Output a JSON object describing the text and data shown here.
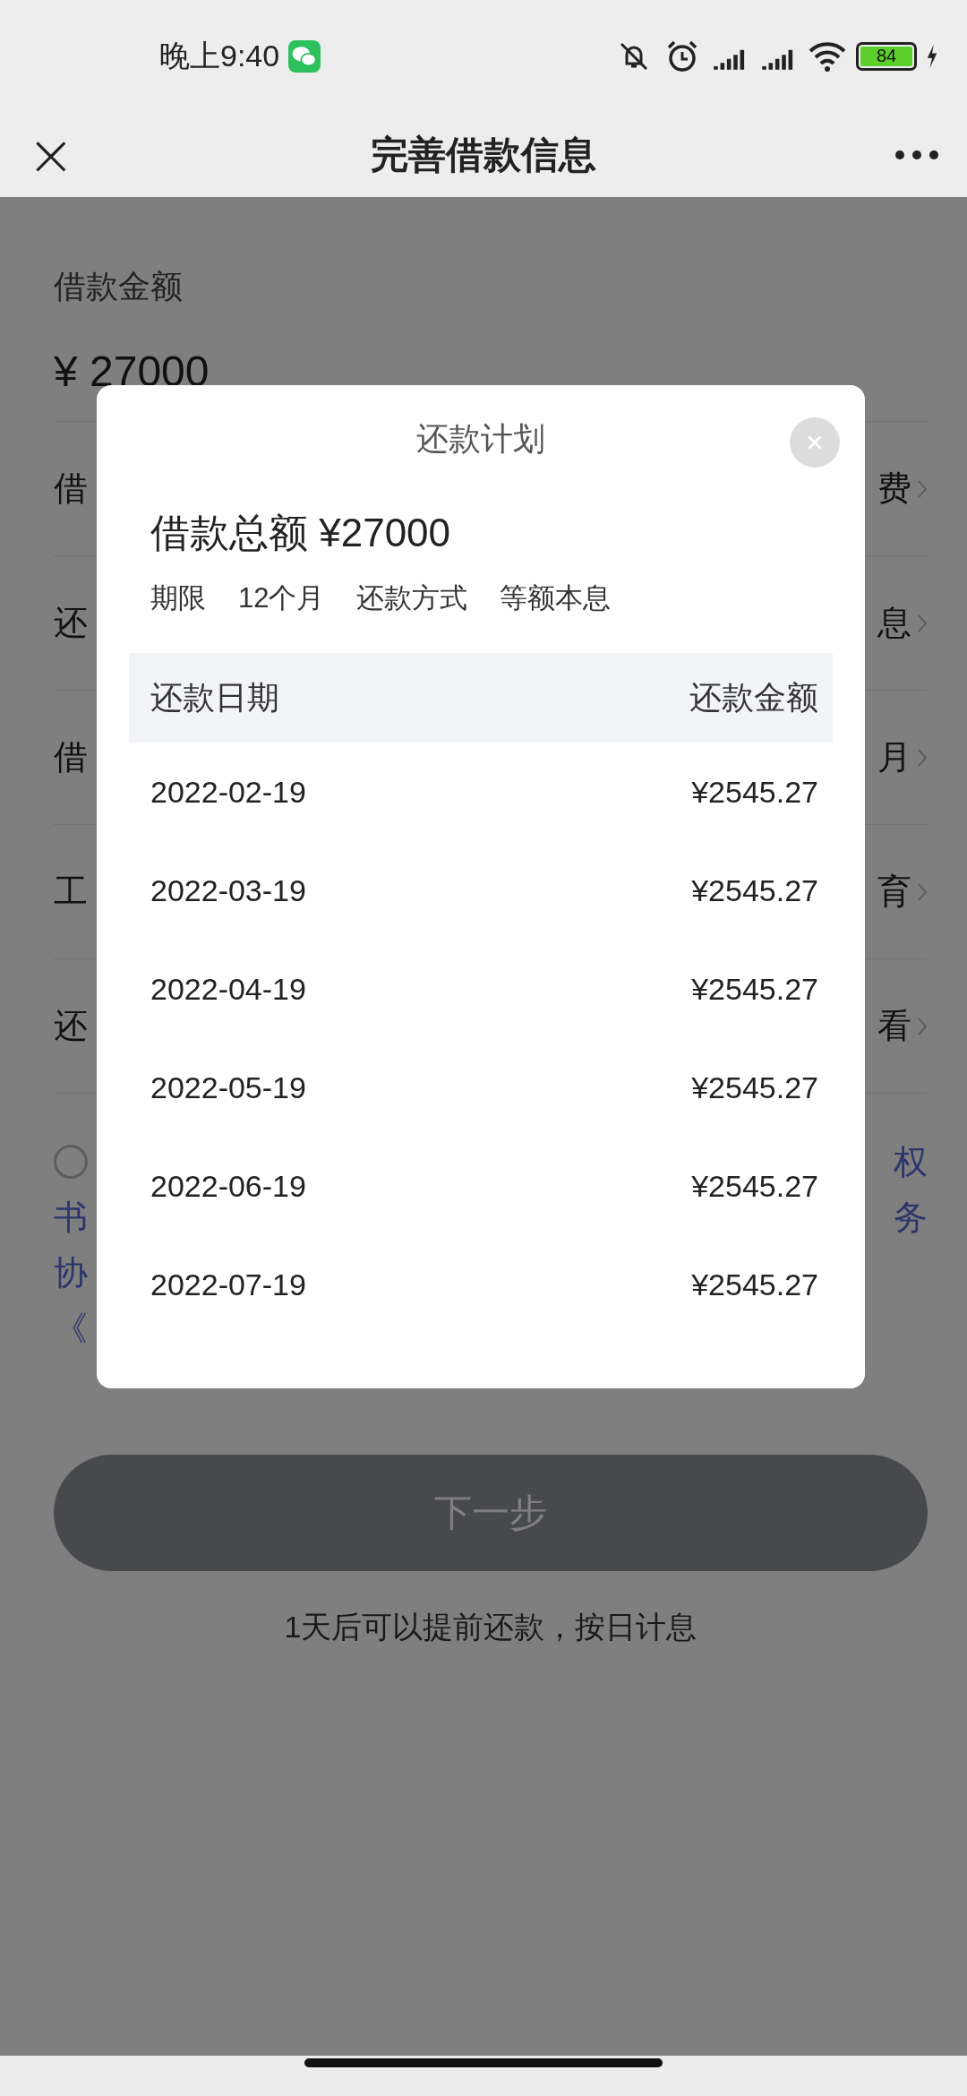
{
  "status_bar": {
    "time": "晚上9:40",
    "battery": "84"
  },
  "nav_bar": {
    "close": "×",
    "title": "完善借款信息"
  },
  "form": {
    "amount_label": "借款金额",
    "amount_value": "¥ 27000",
    "rows": [
      {
        "label": "借",
        "value": "费"
      },
      {
        "label": "还",
        "value": "息"
      },
      {
        "label": "借",
        "value": "月"
      },
      {
        "label": "工",
        "value": "育"
      },
      {
        "label": "还",
        "value": "看"
      }
    ],
    "agreement": {
      "checked": false,
      "lines": [
        {
          "right": "权"
        },
        {
          "left": "书",
          "right": "务"
        },
        {
          "left": "协"
        },
        {
          "left": "《"
        }
      ]
    },
    "next_button": {
      "label": "下一步",
      "disabled": true
    },
    "note": "1天后可以提前还款，按日计息"
  },
  "dialog": {
    "title": "还款计划",
    "total": "借款总额 ¥27000",
    "terms": [
      "期限",
      "12个月",
      "还款方式",
      "等额本息"
    ],
    "table": {
      "columns": [
        "还款日期",
        "还款金额"
      ],
      "rows": [
        [
          "2022-02-19",
          "¥2545.27"
        ],
        [
          "2022-03-19",
          "¥2545.27"
        ],
        [
          "2022-04-19",
          "¥2545.27"
        ],
        [
          "2022-05-19",
          "¥2545.27"
        ],
        [
          "2022-06-19",
          "¥2545.27"
        ],
        [
          "2022-07-19",
          "¥2545.27"
        ]
      ]
    }
  }
}
